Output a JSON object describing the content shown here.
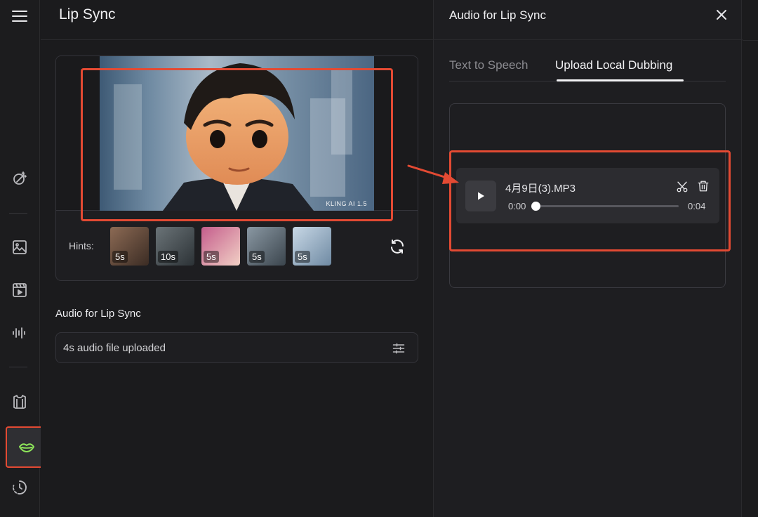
{
  "page": {
    "title": "Lip Sync"
  },
  "preview": {
    "watermark": "KLING AI 1.5",
    "hints_label": "Hints:",
    "hints": [
      {
        "duration": "5s",
        "color_a": "#8c6a54",
        "color_b": "#3b2c24"
      },
      {
        "duration": "10s",
        "color_a": "#6b7478",
        "color_b": "#2c3236"
      },
      {
        "duration": "5s",
        "color_a": "#c55d8c",
        "color_b": "#f1d0c5"
      },
      {
        "duration": "5s",
        "color_a": "#8a98a3",
        "color_b": "#3b454d"
      },
      {
        "duration": "5s",
        "color_a": "#c8d8e6",
        "color_b": "#6f8aa3"
      }
    ]
  },
  "audio_section": {
    "label": "Audio for Lip Sync",
    "status": "4s audio file uploaded"
  },
  "panel": {
    "title": "Audio for Lip Sync",
    "tabs": [
      {
        "label": "Text to Speech",
        "active": false
      },
      {
        "label": "Upload Local Dubbing",
        "active": true
      }
    ],
    "player": {
      "file_name": "4月9日(3).MP3",
      "current_time": "0:00",
      "duration": "0:04",
      "progress": 0.0
    }
  },
  "colors": {
    "highlight": "#e34a33",
    "accent_green": "#8ee65a"
  },
  "rail": {
    "icons": [
      "menu-icon",
      "magic-wand-icon",
      "image-icon",
      "video-icon",
      "audio-wave-icon",
      "shirt-icon",
      "lip-icon",
      "history-icon"
    ],
    "active": "lip-icon"
  }
}
